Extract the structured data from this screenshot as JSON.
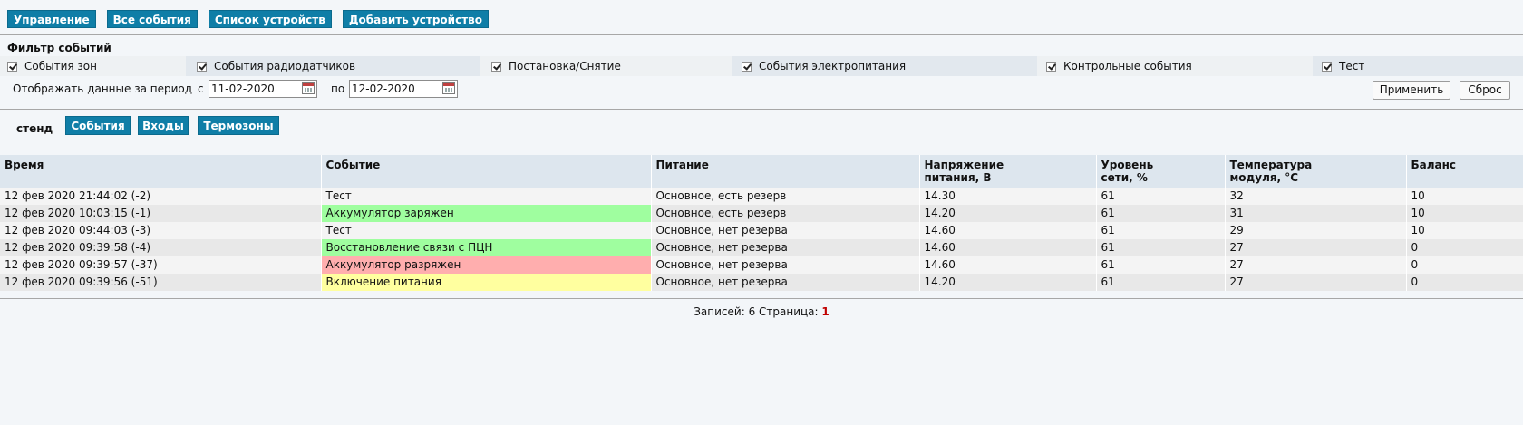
{
  "nav": {
    "manage": "Управление",
    "all_events": "Все события",
    "device_list": "Список устройств",
    "add_device": "Добавить устройство"
  },
  "filter": {
    "title": "Фильтр событий",
    "checks": [
      {
        "label": "События зон",
        "checked": true
      },
      {
        "label": "События радиодатчиков",
        "checked": true
      },
      {
        "label": "Постановка/Снятие",
        "checked": true
      },
      {
        "label": "События электропитания",
        "checked": true
      },
      {
        "label": "Контрольные события",
        "checked": true
      },
      {
        "label": "Тест",
        "checked": true
      }
    ],
    "period_label": "Отображать данные за период",
    "from_label": "с",
    "from_value": "11-02-2020",
    "to_label": "по",
    "to_value": "12-02-2020",
    "apply": "Применить",
    "reset": "Сброс"
  },
  "tabs": {
    "device": "стенд",
    "events": "События",
    "inputs": "Входы",
    "thermo": "Термозоны"
  },
  "table": {
    "headers": [
      "Время",
      "Событие",
      "Питание",
      "Напряжение\nпитания, В",
      "Уровень\nсети, %",
      "Температура\nмодуля, °С",
      "Баланс"
    ],
    "rows": [
      {
        "time": "12 фев 2020 21:44:02 (-2)",
        "event": "Тест",
        "status": "none",
        "power": "Основное, есть резерв",
        "voltage": "14.30",
        "level": "61",
        "temp": "32",
        "balance": "10"
      },
      {
        "time": "12 фев 2020 10:03:15 (-1)",
        "event": "Аккумулятор заряжен",
        "status": "green",
        "power": "Основное, есть резерв",
        "voltage": "14.20",
        "level": "61",
        "temp": "31",
        "balance": "10"
      },
      {
        "time": "12 фев 2020 09:44:03 (-3)",
        "event": "Тест",
        "status": "none",
        "power": "Основное, нет резерва",
        "voltage": "14.60",
        "level": "61",
        "temp": "29",
        "balance": "10"
      },
      {
        "time": "12 фев 2020 09:39:58 (-4)",
        "event": "Восстановление связи с ПЦН",
        "status": "green",
        "power": "Основное, нет резерва",
        "voltage": "14.60",
        "level": "61",
        "temp": "27",
        "balance": "0"
      },
      {
        "time": "12 фев 2020 09:39:57 (-37)",
        "event": "Аккумулятор разряжен",
        "status": "red",
        "power": "Основное, нет резерва",
        "voltage": "14.60",
        "level": "61",
        "temp": "27",
        "balance": "0"
      },
      {
        "time": "12 фев 2020 09:39:56 (-51)",
        "event": "Включение питания",
        "status": "yellow",
        "power": "Основное, нет резерва",
        "voltage": "14.20",
        "level": "61",
        "temp": "27",
        "balance": "0"
      }
    ]
  },
  "footer": {
    "records_label": "Записей: 6 Страница:",
    "page": "1"
  },
  "colors": {
    "button": "#0f7ea7",
    "event_green": "#9ffe9f",
    "event_red": "#ffaeae",
    "event_yellow": "#ffff9f",
    "page_number": "#c00000"
  }
}
